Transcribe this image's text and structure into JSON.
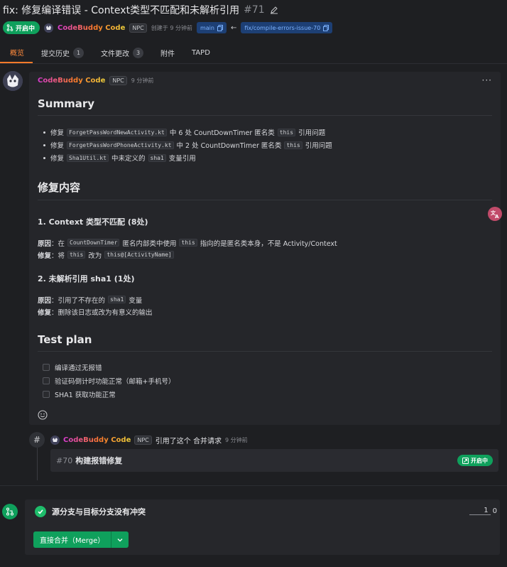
{
  "pr": {
    "title": "fix: 修复编译错误 - Context类型不匹配和未解析引用",
    "number": "#71",
    "state_label": "开启中",
    "author": "CodeBuddy Code",
    "author_badge": "NPC",
    "created_text": "创建于 9 分钟前",
    "target_branch": "main",
    "arrow": "←",
    "source_branch": "fix/compile-errors-issue-70"
  },
  "tabs": [
    {
      "label": "概览",
      "count": null
    },
    {
      "label": "提交历史",
      "count": "1"
    },
    {
      "label": "文件更改",
      "count": "3"
    },
    {
      "label": "附件",
      "count": null
    },
    {
      "label": "TAPD",
      "count": null
    }
  ],
  "comment": {
    "author": "CodeBuddy Code",
    "badge": "NPC",
    "time": "9 分钟前",
    "more": "···",
    "summary_heading": "Summary",
    "summary_items": [
      {
        "pre": "修复",
        "code": "ForgetPassWordNewActivity.kt",
        "post": "中 6 处 CountDownTimer 匿名类",
        "code2": "this",
        "post2": "引用问题"
      },
      {
        "pre": "修复",
        "code": "ForgetPassWordPhoneActivity.kt",
        "post": "中 2 处 CountDownTimer 匿名类",
        "code2": "this",
        "post2": "引用问题"
      },
      {
        "pre": "修复",
        "code": "Sha1Util.kt",
        "post": "中未定义的",
        "code2": "sha1",
        "post2": "变量引用"
      }
    ],
    "fix_heading": "修复内容",
    "fix1": {
      "heading": "1. Context 类型不匹配 (8处)",
      "cause_label": "原因",
      "cause_pre": "：在",
      "cause_code": "CountDownTimer",
      "cause_mid": "匿名内部类中使用",
      "cause_code2": "this",
      "cause_post": "指向的是匿名类本身，不是 Activity/Context",
      "fix_label": "修复",
      "fix_pre": "：将",
      "fix_code": "this",
      "fix_mid": "改为",
      "fix_code2": "this@[ActivityName]"
    },
    "fix2": {
      "heading": "2. 未解析引用 sha1 (1处)",
      "cause_label": "原因",
      "cause_pre": "：引用了不存在的",
      "cause_code": "sha1",
      "cause_post": "变量",
      "fix_label": "修复",
      "fix_text": "：删除该日志或改为有意义的输出"
    },
    "test_heading": "Test plan",
    "tasks": [
      "编译通过无报错",
      "验证码倒计时功能正常（邮箱+手机号）",
      "SHA1 获取功能正常"
    ]
  },
  "event": {
    "author": "CodeBuddy Code",
    "badge": "NPC",
    "text": "引用了这个 合并请求",
    "time": "9 分钟前",
    "ref_number": "#70",
    "ref_title": "构建报错修复",
    "ref_state": "开启中"
  },
  "merge": {
    "status": "源分支与目标分支没有冲突",
    "counter_a": "1",
    "counter_b": "0",
    "button_label": "直接合并（Merge）"
  },
  "colors": {
    "accent": "#ff7a2a",
    "open_green": "#0fa05c",
    "branch_blue": "#1d3f74"
  }
}
